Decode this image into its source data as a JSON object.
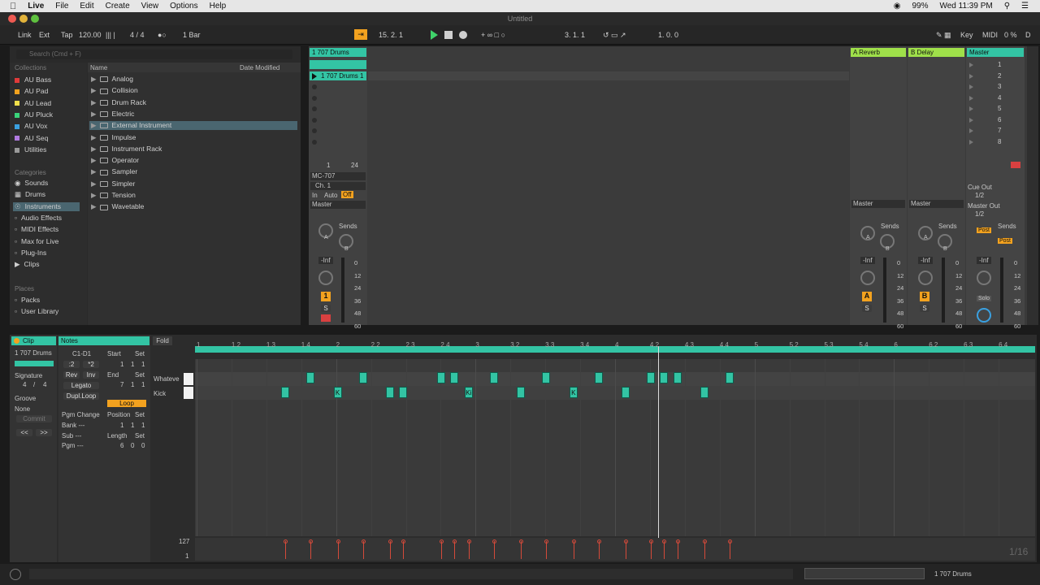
{
  "menubar": {
    "app": "Live",
    "items": [
      "File",
      "Edit",
      "Create",
      "View",
      "Options",
      "Help"
    ],
    "battery": "99%",
    "clock": "Wed 11:39 PM"
  },
  "window": {
    "title": "Untitled"
  },
  "control_bar": {
    "link": "Link",
    "ext": "Ext",
    "tap": "Tap",
    "tempo": "120.00",
    "time_sig": "4 / 4",
    "quantize": "1 Bar",
    "position": "15.  2.  1",
    "loop_start": "3.  1.  1",
    "loop_len": "1.  0.  0",
    "key": "Key",
    "midi": "MIDI",
    "cpu": "0 %",
    "d": "D"
  },
  "browser": {
    "search_placeholder": "Search (Cmd + F)",
    "collections_head": "Collections",
    "collections": [
      {
        "label": "AU Bass",
        "color": "#e03a3a"
      },
      {
        "label": "AU Pad",
        "color": "#f3a21f"
      },
      {
        "label": "AU Lead",
        "color": "#f1e04b"
      },
      {
        "label": "AU Pluck",
        "color": "#3ad47a"
      },
      {
        "label": "AU Vox",
        "color": "#3aa0e0"
      },
      {
        "label": "AU Seq",
        "color": "#b07ae0"
      },
      {
        "label": "Utilities",
        "color": "#9a9a9a"
      }
    ],
    "categories_head": "Categories",
    "categories": [
      "Sounds",
      "Drums",
      "Instruments",
      "Audio Effects",
      "MIDI Effects",
      "Max for Live",
      "Plug-Ins",
      "Clips"
    ],
    "places_head": "Places",
    "places": [
      "Packs",
      "User Library"
    ],
    "col_name": "Name",
    "col_date": "Date Modified",
    "files": [
      "Analog",
      "Collision",
      "Drum Rack",
      "Electric",
      "External Instrument",
      "Impulse",
      "Instrument Rack",
      "Operator",
      "Sampler",
      "Simpler",
      "Tension",
      "Wavetable"
    ],
    "selected_file": "External Instrument"
  },
  "session": {
    "track1": {
      "name": "1 707 Drums",
      "clip": "1 707 Drums 1",
      "midi_from": "MC-707",
      "channel": "Ch. 1",
      "monitor": [
        "In",
        "Auto",
        "Off"
      ],
      "out": "Master",
      "sends": "Sends",
      "volume": "-Inf",
      "number": "1",
      "meter": [
        "0",
        "12",
        "24",
        "36",
        "48",
        "60"
      ],
      "s": "S",
      "slider_a": "1",
      "slider_b": "24"
    },
    "return_a": {
      "name": "A Reverb",
      "out": "Master",
      "sends": "Sends",
      "volume": "-Inf",
      "btn": "A",
      "s": "S"
    },
    "return_b": {
      "name": "B Delay",
      "out": "Master",
      "sends": "Sends",
      "volume": "-Inf",
      "btn": "B",
      "s": "S"
    },
    "master": {
      "name": "Master",
      "scenes": [
        "1",
        "2",
        "3",
        "4",
        "5",
        "6",
        "7",
        "8"
      ],
      "cue_out_label": "Cue Out",
      "cue_out": "1/2",
      "master_out_label": "Master Out",
      "master_out": "1/2",
      "sends": "Sends",
      "post": "Post",
      "volume": "-Inf",
      "solo": "Solo"
    },
    "send_labels": [
      "A",
      "B"
    ],
    "meter_marks": [
      "0",
      "12",
      "24",
      "36",
      "48",
      "60"
    ]
  },
  "clip_panel": {
    "clip_tab": "Clip",
    "clip_name": "1 707 Drums",
    "signature_label": "Signature",
    "sig_num": "4",
    "sig_den": "4",
    "groove_label": "Groove",
    "groove_value": "None",
    "commit": "Commit",
    "notes_tab": "Notes",
    "range": "C1-D1",
    "div2": ":2",
    "mul2": "*2",
    "rev": "Rev",
    "inv": "Inv",
    "legato": "Legato",
    "dupl": "Dupl.Loop",
    "start_label": "Start",
    "start_set": "Set",
    "start_val": [
      "1",
      "1",
      "1"
    ],
    "end_label": "End",
    "end_set": "Set",
    "end_val": [
      "7",
      "1",
      "1"
    ],
    "loop": "Loop",
    "position_label": "Position",
    "position_set": "Set",
    "position_val": [
      "1",
      "1",
      "1"
    ],
    "length_label": "Length",
    "length_set": "Set",
    "length_val": [
      "6",
      "0",
      "0"
    ],
    "pgm_change": "Pgm Change",
    "bank": "Bank ---",
    "sub": "Sub ---",
    "pgm": "Pgm ---",
    "nav_prev": "<<",
    "nav_next": ">>"
  },
  "piano_roll": {
    "fold": "Fold",
    "lanes": [
      "Whateve",
      "Kick"
    ],
    "ruler": [
      "1",
      "1.2",
      "1.3",
      "1.4",
      "2",
      "2.2",
      "2.3",
      "2.4",
      "3",
      "3.2",
      "3.3",
      "3.4",
      "4",
      "4.2",
      "4.3",
      "4.4",
      "5",
      "5.2",
      "5.3",
      "5.4",
      "6",
      "6.2",
      "6.3",
      "6.4"
    ],
    "vel_max": "127",
    "vel_min": "1",
    "grid": "1/16",
    "notes_top_beats": [
      0.5,
      1.0,
      1.75,
      1.875,
      2.25,
      2.75,
      3.25,
      3.75,
      3.875,
      4.0,
      4.5
    ],
    "notes_bottom_beats": [
      0.25,
      0.75,
      1.25,
      1.375,
      2.0,
      2.5,
      3.0,
      3.5,
      4.25
    ],
    "kick_labels": {
      "1": "K",
      "4": "Ki",
      "6": "K"
    }
  },
  "status_bar": {
    "track_name": "1 707 Drums"
  }
}
